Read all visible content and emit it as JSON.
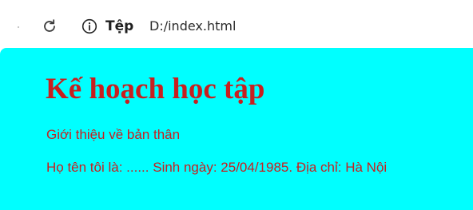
{
  "browser": {
    "reload_icon": "reload-icon",
    "site_info_icon": "info-circle-icon",
    "site_info_label": "Tệp",
    "url": "D:/index.html"
  },
  "page": {
    "heading": "Kế hoạch học tập",
    "intro": "Giới thiệu về bản thân",
    "details": "Họ tên tôi là: ...... Sinh ngày: 25/04/1985. Địa chỉ: Hà Nội"
  },
  "colors": {
    "page_background": "#00ffff",
    "text": "#c81f1f"
  }
}
